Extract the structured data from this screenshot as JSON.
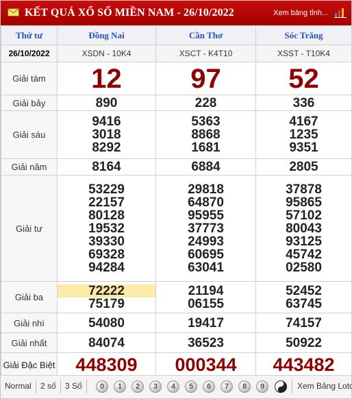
{
  "header": {
    "title": "KẾT QUẢ XỔ SỐ MIỀN NAM - 26/10/2022",
    "link": "Xem bảng tỉnh..."
  },
  "columns": {
    "day": "Thứ tư",
    "provinces": [
      "Đồng Nai",
      "Cần Thơ",
      "Sóc Trăng"
    ]
  },
  "draw": {
    "date": "26/10/2022",
    "codes": [
      "XSDN - 10K4",
      "XSCT - K4T10",
      "XSST - T10K4"
    ]
  },
  "prizes": [
    {
      "label": "Giải tám",
      "values": [
        [
          "12"
        ],
        [
          "97"
        ],
        [
          "52"
        ]
      ]
    },
    {
      "label": "Giải bảy",
      "values": [
        [
          "890"
        ],
        [
          "228"
        ],
        [
          "336"
        ]
      ]
    },
    {
      "label": "Giải sáu",
      "values": [
        [
          "9416",
          "3018",
          "8292"
        ],
        [
          "5363",
          "8868",
          "1681"
        ],
        [
          "4167",
          "1235",
          "9351"
        ]
      ]
    },
    {
      "label": "Giải năm",
      "values": [
        [
          "8164"
        ],
        [
          "6884"
        ],
        [
          "2805"
        ]
      ]
    },
    {
      "label": "Giải tư",
      "values": [
        [
          "53229",
          "22157",
          "80128",
          "19532",
          "39330",
          "69328",
          "94284"
        ],
        [
          "29818",
          "64870",
          "95955",
          "37773",
          "24993",
          "60695",
          "63041"
        ],
        [
          "37878",
          "95865",
          "57102",
          "80043",
          "93125",
          "45742",
          "02580"
        ]
      ]
    },
    {
      "label": "Giải ba",
      "values": [
        [
          "72222",
          "75179"
        ],
        [
          "21194",
          "06155"
        ],
        [
          "52452",
          "63745"
        ]
      ]
    },
    {
      "label": "Giải nhì",
      "values": [
        [
          "54080"
        ],
        [
          "19417"
        ],
        [
          "74157"
        ]
      ]
    },
    {
      "label": "Giải nhất",
      "values": [
        [
          "84074"
        ],
        [
          "36523"
        ],
        [
          "50922"
        ]
      ]
    },
    {
      "label": "Giải Đặc Biệt",
      "values": [
        [
          "448309"
        ],
        [
          "000344"
        ],
        [
          "443482"
        ]
      ]
    }
  ],
  "highlight": "72222",
  "footer": {
    "tabs": [
      "Normal",
      "2 số",
      "3 Số"
    ],
    "digits": [
      "0",
      "1",
      "2",
      "3",
      "4",
      "5",
      "6",
      "7",
      "8",
      "9"
    ],
    "loto_link": "Xem Bảng Loto"
  },
  "colors": {
    "header_bg": "#b30000",
    "prize_red": "#8b0000",
    "province_blue": "#2255bb",
    "highlight": "#fde9a8"
  },
  "icons": [
    "mail-icon",
    "chart-icon",
    "yin-yang-icon"
  ]
}
